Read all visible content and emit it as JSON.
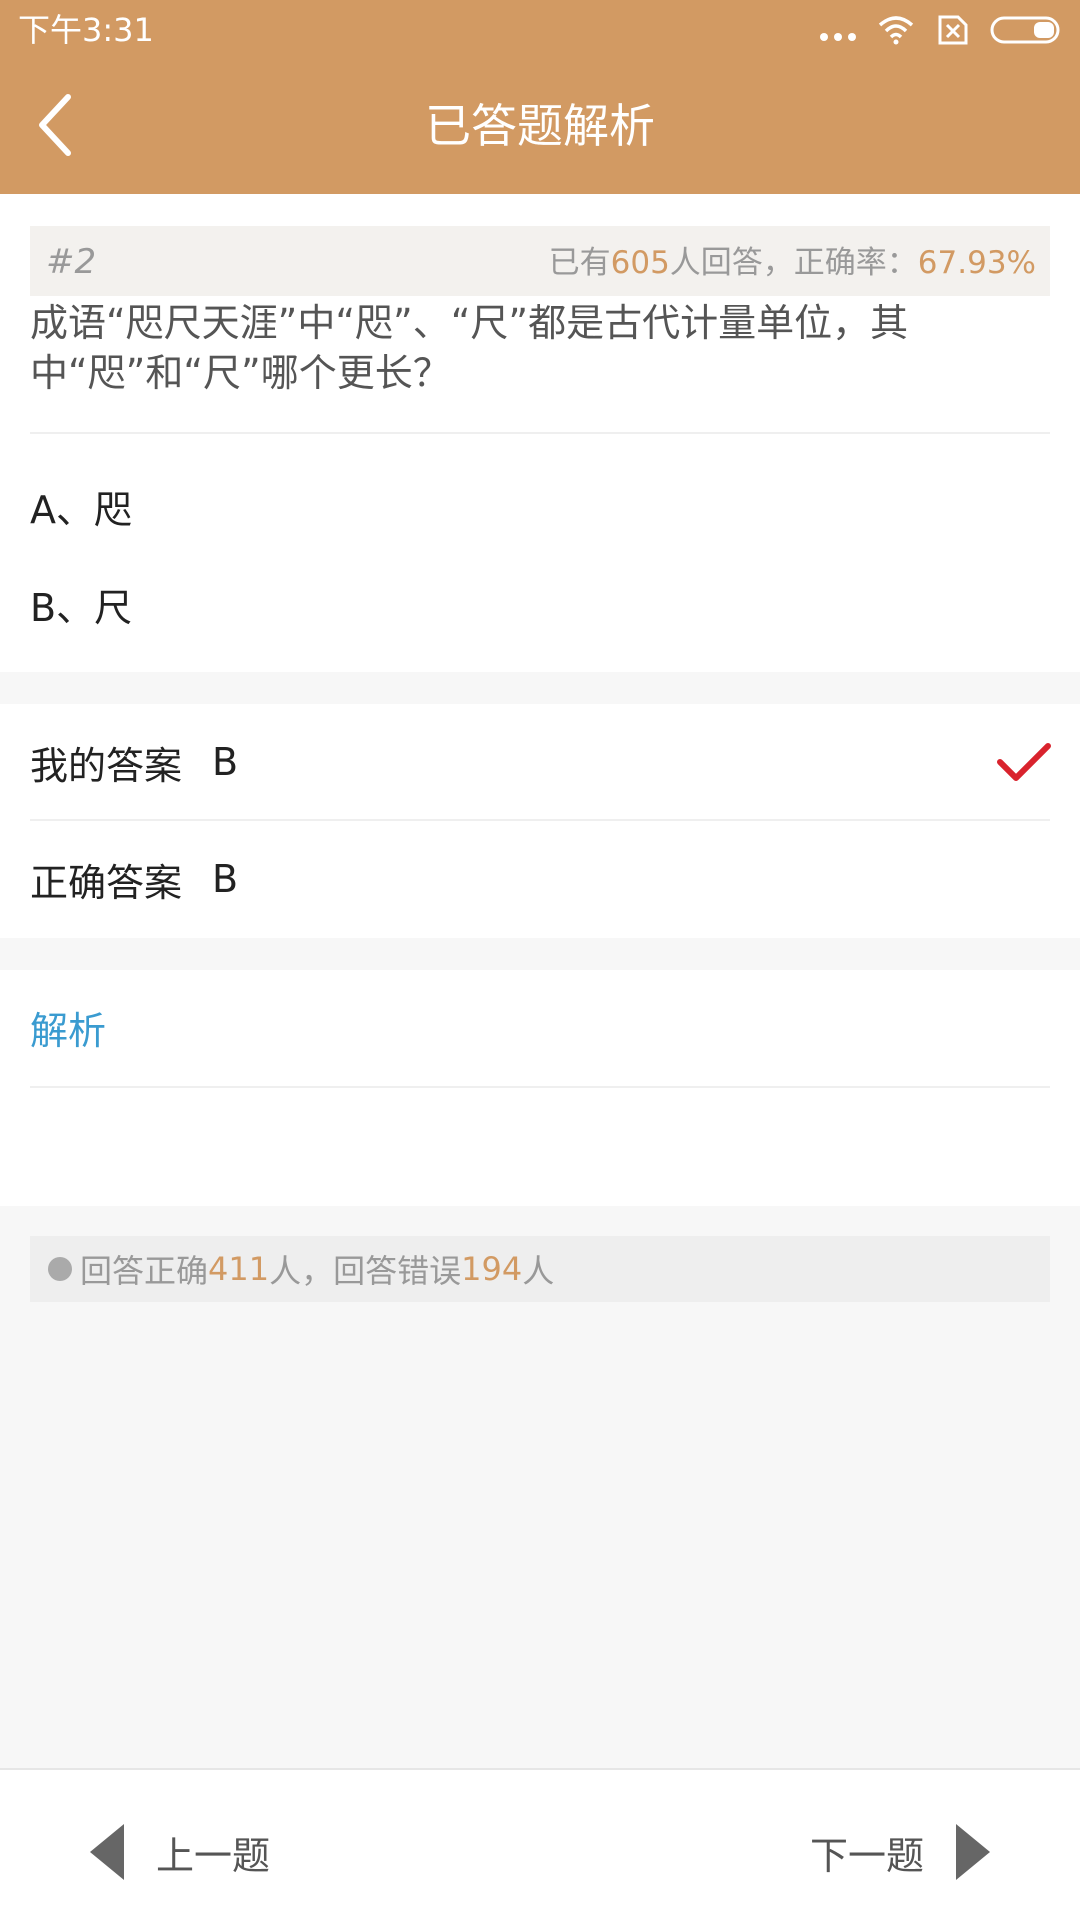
{
  "status_bar": {
    "time": "下午3:31",
    "icons": [
      "more-dots-icon",
      "wifi-icon",
      "no-sim-icon",
      "battery-icon"
    ]
  },
  "header": {
    "title": "已答题解析",
    "back_icon": "chevron-left-icon"
  },
  "question": {
    "number": "#2",
    "stats_prefix": "已有",
    "answer_count": "605",
    "stats_middle": "人回答，正确率：",
    "accuracy": "67.93%",
    "text": "成语“咫尺天涯”中“咫”、“尺”都是古代计量单位，其中“咫”和“尺”哪个更长？",
    "options": [
      {
        "label": "A、咫"
      },
      {
        "label": "B、尺"
      }
    ]
  },
  "answers": {
    "my_label": "我的答案",
    "my_value": "B",
    "my_status_icon": "checkmark-icon",
    "correct_label": "正确答案",
    "correct_value": "B"
  },
  "analysis": {
    "title": "解析"
  },
  "summary": {
    "correct_prefix": "回答正确",
    "correct_count": "411",
    "middle": "人，回答错误",
    "wrong_count": "194",
    "suffix": "人"
  },
  "bottom_nav": {
    "prev_label": "上一题",
    "next_label": "下一题"
  },
  "colors": {
    "brand": "#d29a63",
    "link": "#3a9bd0",
    "check": "#d9232d"
  }
}
